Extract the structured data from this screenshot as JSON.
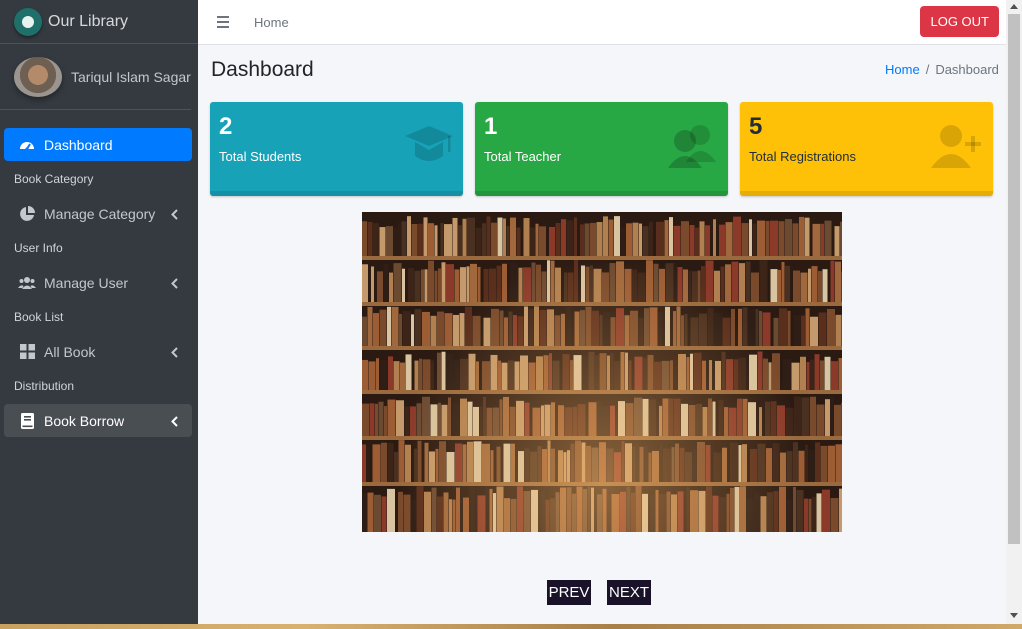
{
  "brand": {
    "name": "Our Library"
  },
  "user": {
    "name": "Tariqul Islam Sagar"
  },
  "sidebar": {
    "items": [
      {
        "type": "item",
        "label": "Dashboard",
        "icon": "tachometer-icon",
        "active": true
      },
      {
        "type": "header",
        "label": "Book Category"
      },
      {
        "type": "item",
        "label": "Manage Category",
        "icon": "pie-chart-icon"
      },
      {
        "type": "header",
        "label": "User Info"
      },
      {
        "type": "item",
        "label": "Manage User",
        "icon": "users-icon"
      },
      {
        "type": "header",
        "label": "Book List"
      },
      {
        "type": "item",
        "label": "All Book",
        "icon": "grid-icon"
      },
      {
        "type": "header",
        "label": "Distribution"
      },
      {
        "type": "item",
        "label": "Book Borrow",
        "icon": "book-icon"
      }
    ]
  },
  "topbar": {
    "home_label": "Home",
    "logout_label": "LOG OUT"
  },
  "page": {
    "title": "Dashboard",
    "breadcrumb": {
      "home": "Home",
      "separator": "/",
      "current": "Dashboard"
    }
  },
  "stats": [
    {
      "value": "2",
      "label": "Total Students",
      "color": "#17a2b8",
      "icon": "graduation-cap-icon"
    },
    {
      "value": "1",
      "label": "Total Teacher",
      "color": "#28a745",
      "icon": "user-group-icon"
    },
    {
      "value": "5",
      "label": "Total Registrations",
      "color": "#ffc107",
      "icon": "user-plus-icon"
    }
  ],
  "slider": {
    "prev_label": "PREV",
    "next_label": "NEXT"
  },
  "colors": {
    "sidebar": "#343a40",
    "primary": "#007bff",
    "danger": "#dc3545"
  }
}
